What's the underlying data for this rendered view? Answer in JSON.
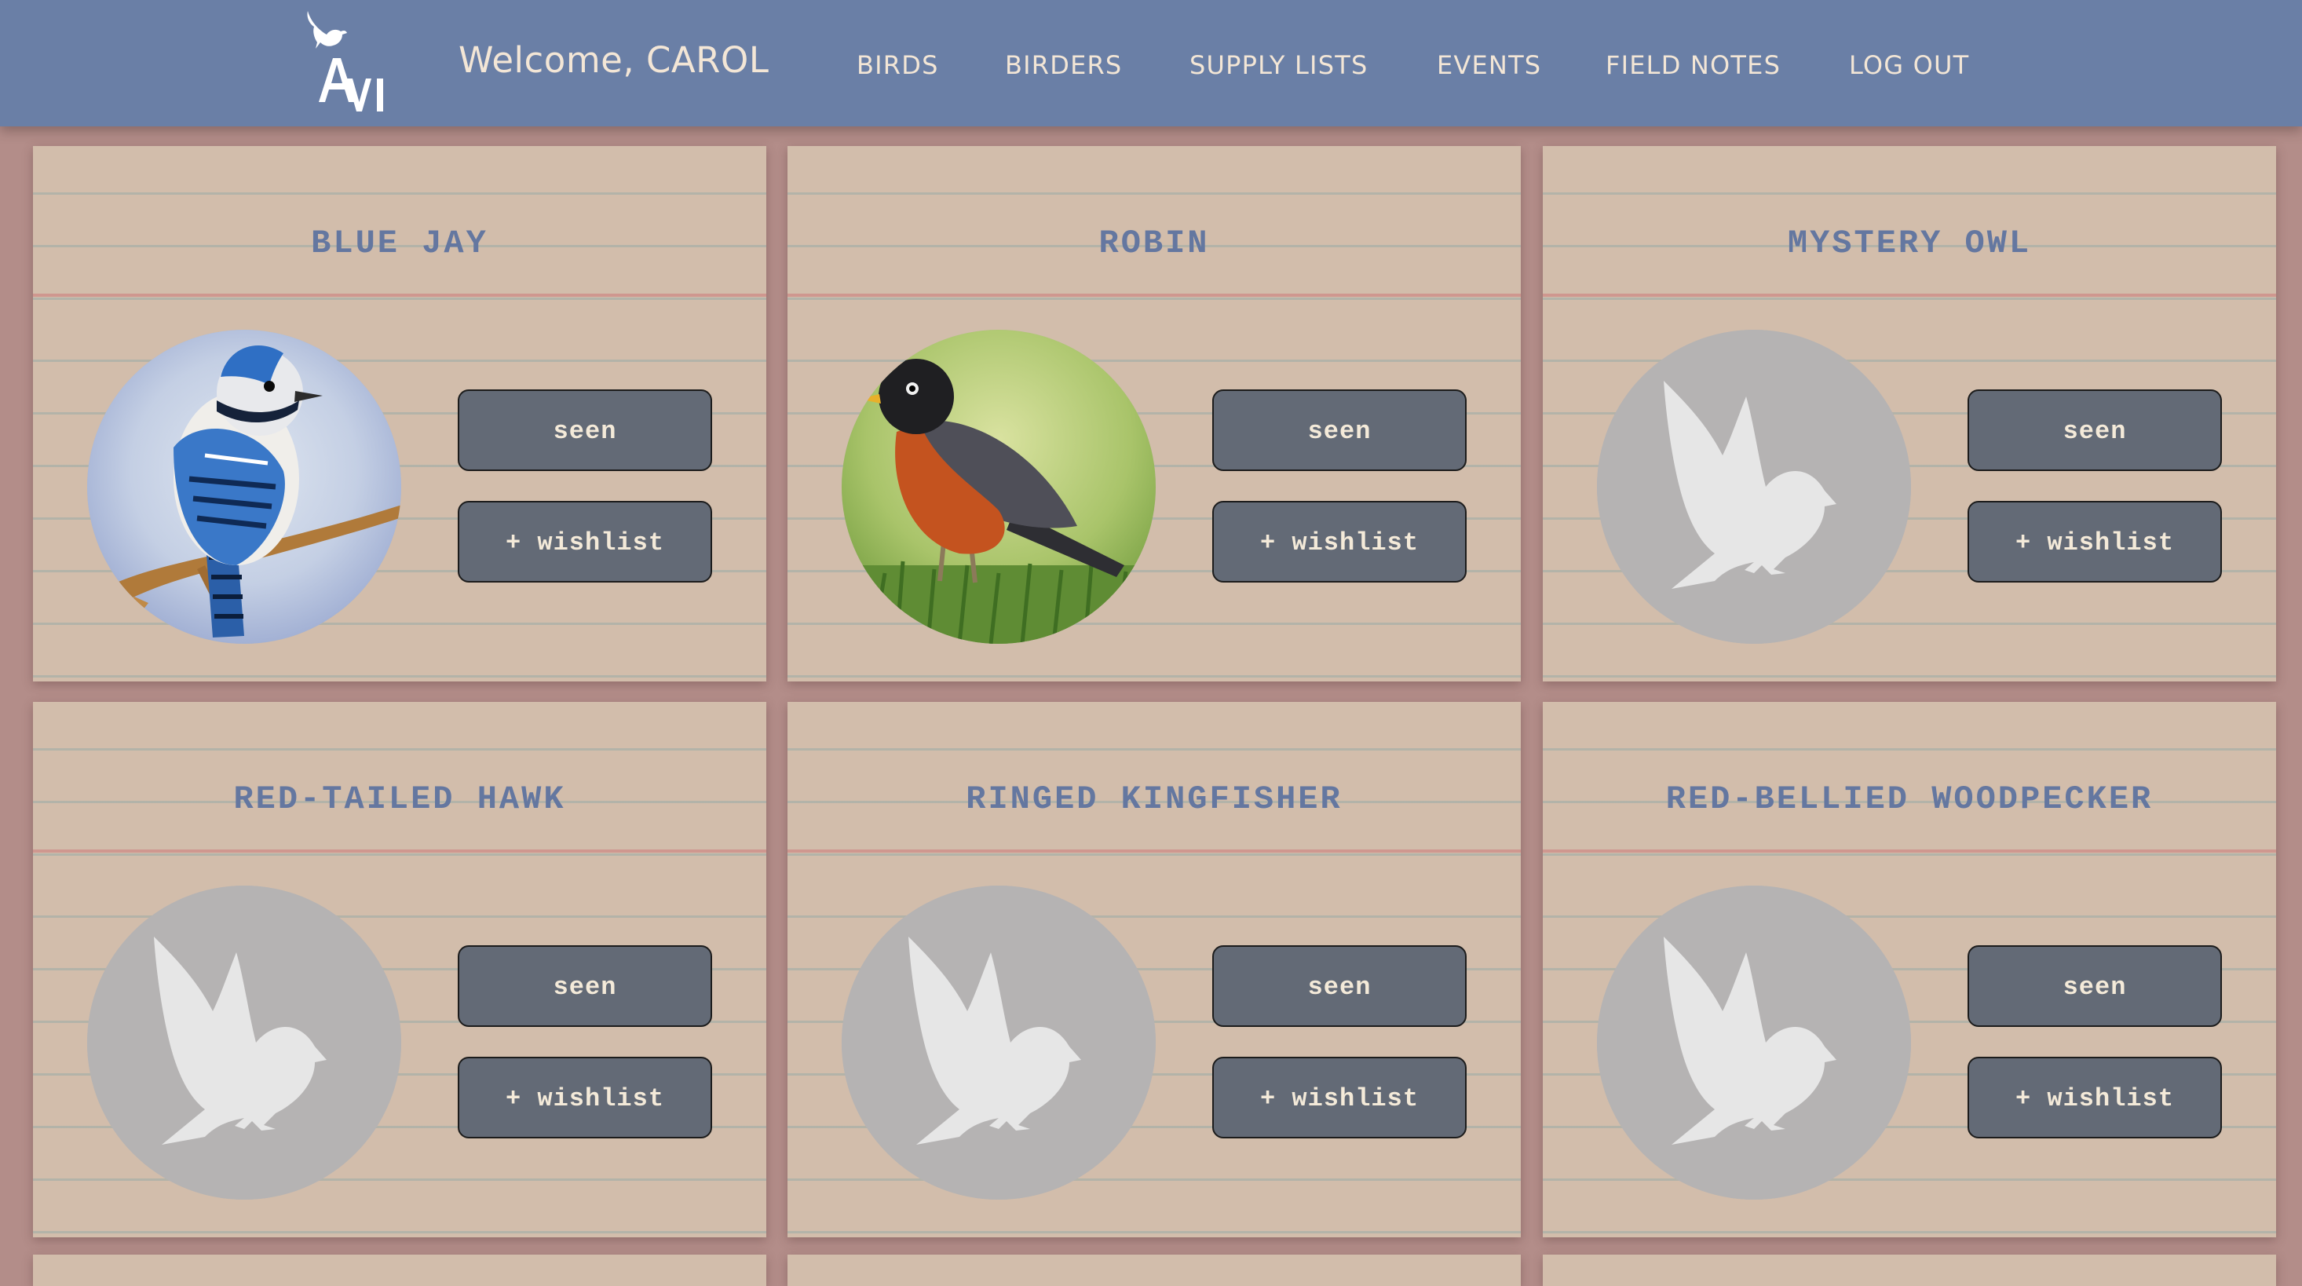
{
  "header": {
    "logo_text": "AVI",
    "welcome": "Welcome, CAROL",
    "nav": [
      "BIRDS",
      "BIRDERS",
      "SUPPLY LISTS",
      "EVENTS",
      "FIELD NOTES",
      "LOG OUT"
    ]
  },
  "colors": {
    "header_bg": "#6a7fa6",
    "page_bg": "#b38d89",
    "card_bg": "#d2bdab",
    "title_color": "#6477a0",
    "button_bg": "#636a76",
    "button_text": "#f4ead9",
    "placeholder_bg": "#b5b3b3"
  },
  "birds": [
    {
      "name": "BLUE JAY",
      "image": "blue-jay-photo",
      "seen_label": "seen",
      "wishlist_label": "+ wishlist"
    },
    {
      "name": "ROBIN",
      "image": "robin-photo",
      "seen_label": "seen",
      "wishlist_label": "+ wishlist"
    },
    {
      "name": "MYSTERY OWL",
      "image": "bird-placeholder-icon",
      "seen_label": "seen",
      "wishlist_label": "+ wishlist"
    },
    {
      "name": "RED-TAILED HAWK",
      "image": "bird-placeholder-icon",
      "seen_label": "seen",
      "wishlist_label": "+ wishlist"
    },
    {
      "name": "RINGED KINGFISHER",
      "image": "bird-placeholder-icon",
      "seen_label": "seen",
      "wishlist_label": "+ wishlist"
    },
    {
      "name": "RED-BELLIED WOODPECKER",
      "image": "bird-placeholder-icon",
      "seen_label": "seen",
      "wishlist_label": "+ wishlist"
    }
  ]
}
